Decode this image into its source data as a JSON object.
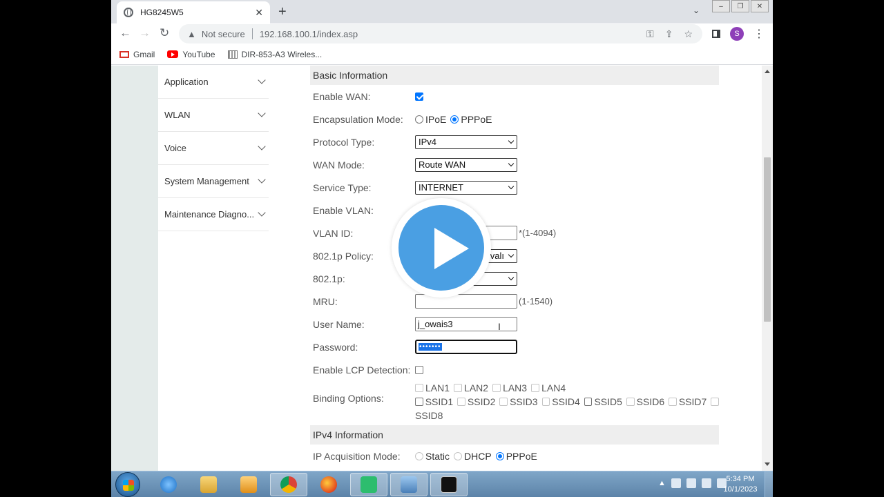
{
  "browser": {
    "tab_title": "HG8245W5",
    "tab_close": "✕",
    "new_tab": "+",
    "security_label": "Not secure",
    "url": "192.168.100.1/index.asp",
    "avatar_letter": "S",
    "bookmarks": [
      {
        "label": "Gmail"
      },
      {
        "label": "YouTube"
      },
      {
        "label": "DIR-853-A3 Wireles..."
      }
    ]
  },
  "sidebar": {
    "items": [
      {
        "label": "Application"
      },
      {
        "label": "WLAN"
      },
      {
        "label": "Voice"
      },
      {
        "label": "System Management"
      },
      {
        "label": "Maintenance Diagno..."
      }
    ]
  },
  "form": {
    "basic_header": "Basic Information",
    "enable_wan": {
      "label": "Enable WAN:",
      "checked": true
    },
    "encapsulation": {
      "label": "Encapsulation Mode:",
      "options": [
        "IPoE",
        "PPPoE"
      ],
      "selected": "PPPoE"
    },
    "protocol_type": {
      "label": "Protocol Type:",
      "value": "IPv4"
    },
    "wan_mode": {
      "label": "WAN Mode:",
      "value": "Route WAN"
    },
    "service_type": {
      "label": "Service Type:",
      "value": "INTERNET"
    },
    "enable_vlan": {
      "label": "Enable VLAN:"
    },
    "vlan_id": {
      "label": "VLAN ID:",
      "hint": "*(1-4094)"
    },
    "policy_8021p": {
      "label": "802.1p Policy:",
      "value": "valı"
    },
    "p8021": {
      "label": "802.1p:"
    },
    "mru": {
      "label": "MRU:",
      "hint": "(1-1540)"
    },
    "username": {
      "label": "User Name:",
      "value": "j_owais3"
    },
    "password": {
      "label": "Password:",
      "value": "•••••••"
    },
    "lcp": {
      "label": "Enable LCP Detection:",
      "checked": false
    },
    "binding": {
      "label": "Binding Options:",
      "lan": [
        "LAN1",
        "LAN2",
        "LAN3",
        "LAN4"
      ],
      "ssid_row": [
        "SSID1",
        "SSID2",
        "SSID3",
        "SSID4",
        "SSID5",
        "SSID6",
        "SSID7"
      ],
      "ssid_last": "SSID8"
    },
    "ipv4_header": "IPv4 Information",
    "ip_acquisition": {
      "label": "IP Acquisition Mode:",
      "options": [
        "Static",
        "DHCP",
        "PPPoE"
      ],
      "selected": "PPPoE"
    }
  },
  "taskbar": {
    "time": "5:34 PM",
    "date": "10/1/2023",
    "apps": [
      "ie-icon",
      "explorer-icon",
      "media-player-icon",
      "chrome-icon",
      "firefox-icon",
      "app-green-icon",
      "network-icon",
      "cmd-icon"
    ]
  },
  "colors": {
    "accent": "#0075ff",
    "play_button": "#4a9fe3",
    "left_margin": "#e4ebea",
    "section_bg": "#eeeeee"
  }
}
